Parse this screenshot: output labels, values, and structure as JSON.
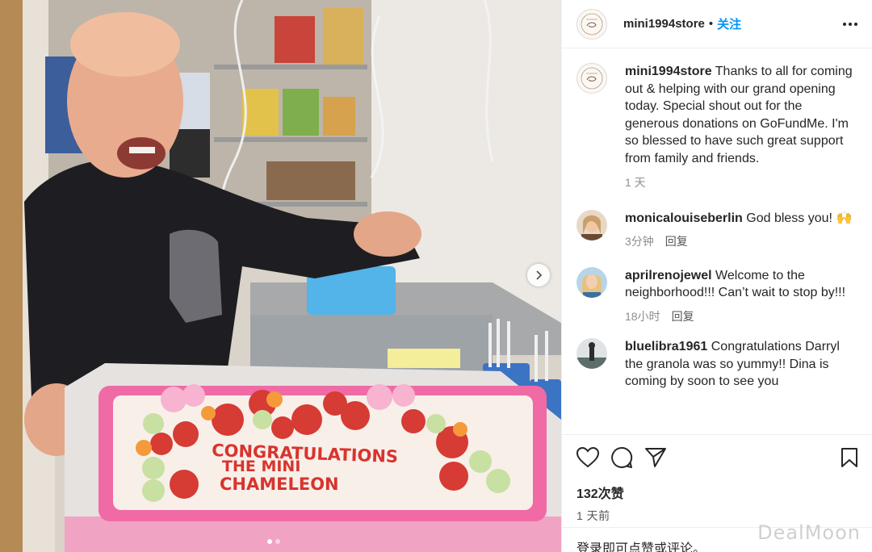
{
  "post": {
    "username": "mini1994store",
    "bullet": "•",
    "follow_label": "关注",
    "caption_text": "Thanks to all for coming out & helping with our grand opening today. Special shout out for the generous donations on GoFundMe. I'm so blessed to have such great support from family and friends.",
    "caption_time": "1 天",
    "likes": "132次赞",
    "post_time": "1 天前",
    "login_link": "登录",
    "login_rest": "即可点赞或评论。",
    "carousel": {
      "slide_count": 2,
      "current": 1
    }
  },
  "cake": {
    "line1": "CONGRATULATIONS",
    "line2": "THE MINI",
    "line3": "CHAMELEON"
  },
  "comments": [
    {
      "user": "monicalouiseberlin",
      "text": "God bless you! 🙌",
      "time": "3分钟",
      "reply": "回复"
    },
    {
      "user": "aprilrenojewel",
      "text": "Welcome to the neighborhood!!! Can’t wait to stop by!!!",
      "time": "18小时",
      "reply": "回复"
    },
    {
      "user": "bluelibra1961",
      "text": "Congratulations Darryl the granola was so yummy!! Dina is coming by soon to see you",
      "time": "",
      "reply": ""
    }
  ],
  "icons": [
    "heart-icon",
    "comment-icon",
    "share-icon",
    "bookmark-icon",
    "more-icon",
    "chevron-right-icon"
  ],
  "colors": {
    "accent": "#0095f6",
    "text": "#262626",
    "muted": "#8e8e8e",
    "cake_pink": "#f06aa6",
    "cake_text": "#d8342e"
  },
  "watermark": "DealMoon"
}
